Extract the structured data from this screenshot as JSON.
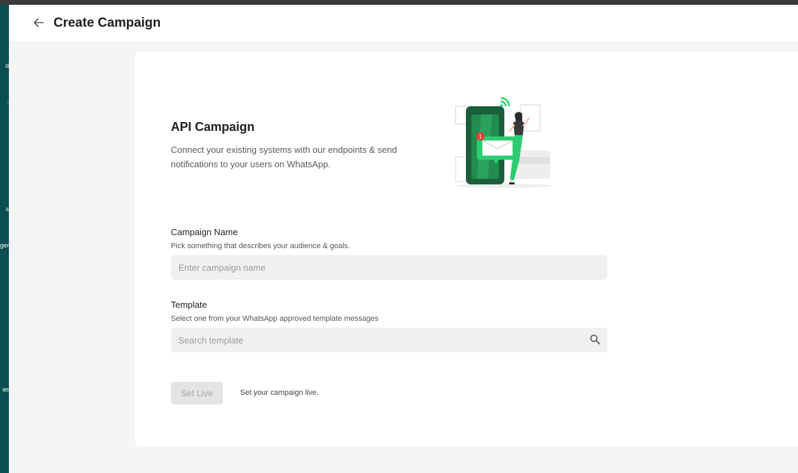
{
  "sidebar": {
    "fragments": [
      "d",
      ":",
      "s",
      "ger",
      "as"
    ]
  },
  "header": {
    "back_icon": "arrow-left-icon",
    "title": "Create Campaign"
  },
  "campaign": {
    "title": "API Campaign",
    "description": "Connect your existing systems with our endpoints & send notifications to your users on WhatsApp.",
    "illustration": "phone-notification-illustration",
    "notification_count": "1"
  },
  "form": {
    "name": {
      "label": "Campaign Name",
      "help": "Pick something that describes your audience & goals.",
      "placeholder": "Enter campaign name",
      "value": ""
    },
    "template": {
      "label": "Template",
      "help": "Select one from your WhatsApp approved template messages",
      "placeholder": "Search template",
      "value": "",
      "icon": "search-icon"
    }
  },
  "actions": {
    "set_live_label": "Set Live",
    "set_live_hint": "Set your campaign live."
  },
  "colors": {
    "sidebar": "#0b4f50",
    "accent_green": "#25d366",
    "dark_green": "#1b5e3b"
  }
}
